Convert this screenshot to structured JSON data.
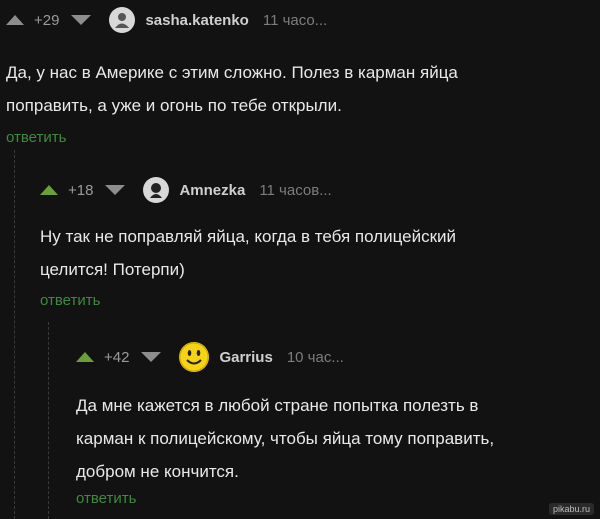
{
  "comments": [
    {
      "rating": "+29",
      "username": "sasha.katenko",
      "time": "11 часо...",
      "text_lines": [
        "Да, у нас в Америке с этим сложно. Полез в карман яйца",
        "поправить, а уже и огонь по тебе открыли."
      ],
      "reply": "ответить",
      "avatar_icon": "person-icon"
    },
    {
      "rating": "+18",
      "username": "Amnezka",
      "time": "11 часов...",
      "text_lines": [
        "Ну так не поправляй яйца, когда в тебя полицейский",
        "целится! Потерпи)"
      ],
      "reply": "ответить",
      "avatar_icon": "person-icon"
    },
    {
      "rating": "+42",
      "username": "Garrius",
      "time": "10 час...",
      "text_lines": [
        "Да мне кажется в любой стране попытка полезть в",
        "карман к полицейскому, чтобы яйца тому поправить,",
        "добром не кончится."
      ],
      "reply": "ответить",
      "avatar_icon": "smiley-icon"
    }
  ],
  "watermark": "pikabu.ru",
  "colors": {
    "background": "#121212",
    "reply_link": "#3e8a3e",
    "upvote_active": "#6a9f3a"
  }
}
